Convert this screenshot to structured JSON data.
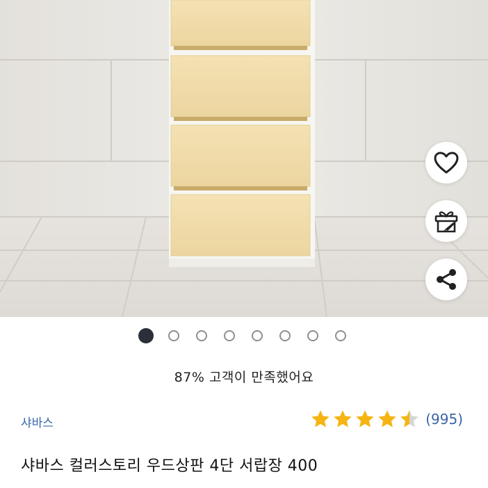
{
  "product_image": {
    "alt": ""
  },
  "actions": {
    "wishlist_icon": "heart-icon",
    "gift_icon": "gift-icon",
    "share_icon": "share-icon"
  },
  "carousel": {
    "total": 8,
    "active_index": 0
  },
  "satisfaction": {
    "text": "87% 고객이 만족했어요"
  },
  "product": {
    "brand": "샤바스",
    "rating": 4.5,
    "rating_max": 5,
    "review_count": "(995)",
    "title": "샤바스 컬러스토리 우드상판 4단 서랍장 400"
  },
  "colors": {
    "star": "#f6b413",
    "star_empty": "#d6d6d6",
    "link": "#3a64a8",
    "active_dot": "#2b2f3a"
  }
}
